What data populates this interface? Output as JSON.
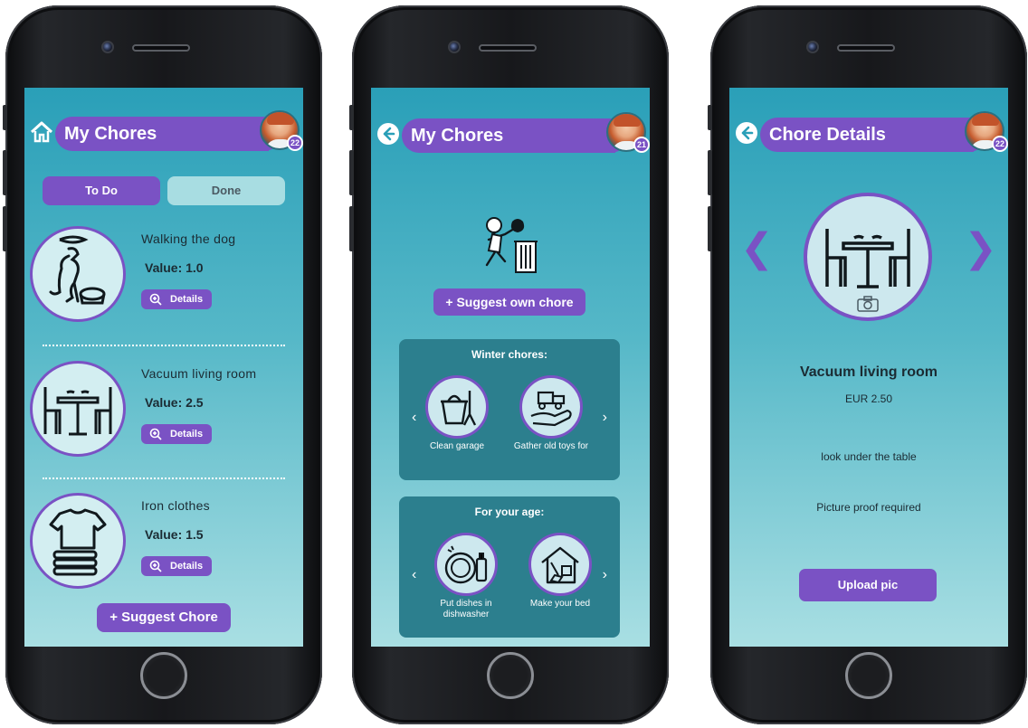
{
  "phone1": {
    "title": "My Chores",
    "badge": "22",
    "tabs": {
      "todo": "To Do",
      "done": "Done"
    },
    "chores": [
      {
        "title": "Walking the dog",
        "value": "Value: 1.0",
        "details": "Details",
        "icon": "dog-walking-icon"
      },
      {
        "title": "Vacuum living room",
        "value": "Value: 2.5",
        "details": "Details",
        "icon": "table-chairs-icon"
      },
      {
        "title": "Iron clothes",
        "value": "Value: 1.5",
        "details": "Details",
        "icon": "folded-shirt-icon"
      }
    ],
    "suggest": "+ Suggest Chore"
  },
  "phone2": {
    "title": "My Chores",
    "badge": "21",
    "suggest_own": "+ Suggest own chore",
    "winter": {
      "title": "Winter chores:",
      "items": [
        {
          "label": "Clean garage"
        },
        {
          "label": "Gather old toys for"
        }
      ]
    },
    "age": {
      "title": "For your age:",
      "items": [
        {
          "label": "Put dishes in dishwasher"
        },
        {
          "label": "Make your bed"
        }
      ]
    },
    "prev_arrow": "‹",
    "next_arrow": "›"
  },
  "phone3": {
    "title": "Chore Details",
    "badge": "22",
    "chore_title": "Vacuum living room",
    "price": "EUR 2.50",
    "description": "look under the table",
    "proof": "Picture proof required",
    "upload": "Upload pic",
    "prev_arrow": "❮",
    "next_arrow": "❯"
  },
  "colors": {
    "accent": "#7a52c4",
    "screen_top": "#2a9fb8",
    "screen_bottom": "#a9dfe3",
    "card": "#2c7f8e"
  }
}
